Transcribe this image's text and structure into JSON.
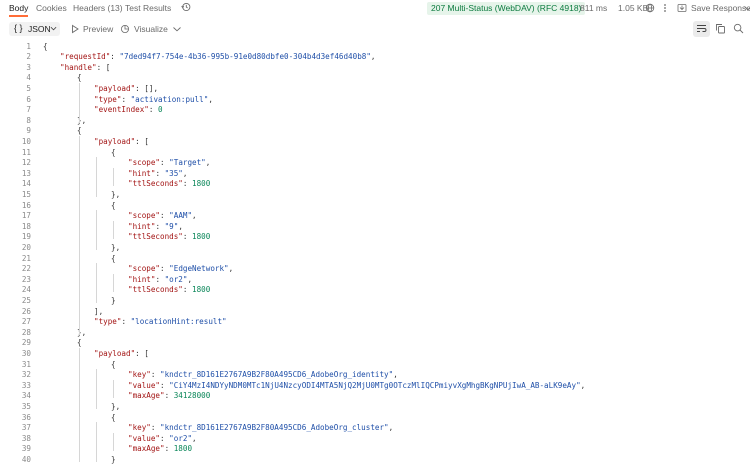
{
  "tabs": {
    "body": "Body",
    "cookies": "Cookies",
    "headers": "Headers (13)",
    "test_results": "Test Results"
  },
  "status": {
    "code_text": "207 Multi-Status (WebDAV) (RFC 4918)",
    "time": "811 ms",
    "size": "1.05 KB",
    "save_response": "Save Response",
    "color": "#0b7a3e"
  },
  "toolbar": {
    "format_icon": "{ }",
    "format": "JSON",
    "preview": "Preview",
    "visualize": "Visualize"
  },
  "icons": [
    "history-icon",
    "globe-icon",
    "more-options-icon",
    "save-icon",
    "chevron-down-icon",
    "play-icon",
    "visualize-icon",
    "wrap-lines-icon",
    "copy-icon",
    "search-icon"
  ],
  "code_lines": [
    [
      {
        "t": "p",
        "v": "{"
      }
    ],
    [
      {
        "t": "k",
        "v": "\"requestId\""
      },
      {
        "t": "p",
        "v": ": "
      },
      {
        "t": "s",
        "v": "\"7ded94f7-754e-4b36-995b-91e0d80dbfe0-304b4d3ef46d40b8\""
      },
      {
        "t": "p",
        "v": ","
      }
    ],
    [
      {
        "t": "k",
        "v": "\"handle\""
      },
      {
        "t": "p",
        "v": ": ["
      }
    ],
    [
      {
        "t": "p",
        "v": "{"
      }
    ],
    [
      {
        "t": "k",
        "v": "\"payload\""
      },
      {
        "t": "p",
        "v": ": [],"
      }
    ],
    [
      {
        "t": "k",
        "v": "\"type\""
      },
      {
        "t": "p",
        "v": ": "
      },
      {
        "t": "s",
        "v": "\"activation:pull\""
      },
      {
        "t": "p",
        "v": ","
      }
    ],
    [
      {
        "t": "k",
        "v": "\"eventIndex\""
      },
      {
        "t": "p",
        "v": ": "
      },
      {
        "t": "n",
        "v": "0"
      }
    ],
    [
      {
        "t": "p",
        "v": "},"
      }
    ],
    [
      {
        "t": "p",
        "v": "{"
      }
    ],
    [
      {
        "t": "k",
        "v": "\"payload\""
      },
      {
        "t": "p",
        "v": ": ["
      }
    ],
    [
      {
        "t": "p",
        "v": "{"
      }
    ],
    [
      {
        "t": "k",
        "v": "\"scope\""
      },
      {
        "t": "p",
        "v": ": "
      },
      {
        "t": "s",
        "v": "\"Target\""
      },
      {
        "t": "p",
        "v": ","
      }
    ],
    [
      {
        "t": "k",
        "v": "\"hint\""
      },
      {
        "t": "p",
        "v": ": "
      },
      {
        "t": "s",
        "v": "\"35\""
      },
      {
        "t": "p",
        "v": ","
      }
    ],
    [
      {
        "t": "k",
        "v": "\"ttlSeconds\""
      },
      {
        "t": "p",
        "v": ": "
      },
      {
        "t": "n",
        "v": "1800"
      }
    ],
    [
      {
        "t": "p",
        "v": "},"
      }
    ],
    [
      {
        "t": "p",
        "v": "{"
      }
    ],
    [
      {
        "t": "k",
        "v": "\"scope\""
      },
      {
        "t": "p",
        "v": ": "
      },
      {
        "t": "s",
        "v": "\"AAM\""
      },
      {
        "t": "p",
        "v": ","
      }
    ],
    [
      {
        "t": "k",
        "v": "\"hint\""
      },
      {
        "t": "p",
        "v": ": "
      },
      {
        "t": "s",
        "v": "\"9\""
      },
      {
        "t": "p",
        "v": ","
      }
    ],
    [
      {
        "t": "k",
        "v": "\"ttlSeconds\""
      },
      {
        "t": "p",
        "v": ": "
      },
      {
        "t": "n",
        "v": "1800"
      }
    ],
    [
      {
        "t": "p",
        "v": "},"
      }
    ],
    [
      {
        "t": "p",
        "v": "{"
      }
    ],
    [
      {
        "t": "k",
        "v": "\"scope\""
      },
      {
        "t": "p",
        "v": ": "
      },
      {
        "t": "s",
        "v": "\"EdgeNetwork\""
      },
      {
        "t": "p",
        "v": ","
      }
    ],
    [
      {
        "t": "k",
        "v": "\"hint\""
      },
      {
        "t": "p",
        "v": ": "
      },
      {
        "t": "s",
        "v": "\"or2\""
      },
      {
        "t": "p",
        "v": ","
      }
    ],
    [
      {
        "t": "k",
        "v": "\"ttlSeconds\""
      },
      {
        "t": "p",
        "v": ": "
      },
      {
        "t": "n",
        "v": "1800"
      }
    ],
    [
      {
        "t": "p",
        "v": "}"
      }
    ],
    [
      {
        "t": "p",
        "v": "],"
      }
    ],
    [
      {
        "t": "k",
        "v": "\"type\""
      },
      {
        "t": "p",
        "v": ": "
      },
      {
        "t": "s",
        "v": "\"locationHint:result\""
      }
    ],
    [
      {
        "t": "p",
        "v": "},"
      }
    ],
    [
      {
        "t": "p",
        "v": "{"
      }
    ],
    [
      {
        "t": "k",
        "v": "\"payload\""
      },
      {
        "t": "p",
        "v": ": ["
      }
    ],
    [
      {
        "t": "p",
        "v": "{"
      }
    ],
    [
      {
        "t": "k",
        "v": "\"key\""
      },
      {
        "t": "p",
        "v": ": "
      },
      {
        "t": "s",
        "v": "\"kndctr_8D161E2767A9B2F80A495CD6_AdobeOrg_identity\""
      },
      {
        "t": "p",
        "v": ","
      }
    ],
    [
      {
        "t": "k",
        "v": "\"value\""
      },
      {
        "t": "p",
        "v": ": "
      },
      {
        "t": "s",
        "v": "\"CiY4MzI4NDYyNDM0MTc1NjU4NzcyODI4MTA5NjQ2MjU0MTg0OTczMlIQCPmiyvXgMhgBKgNPUjIwA_AB-aLK9eAy\""
      },
      {
        "t": "p",
        "v": ","
      }
    ],
    [
      {
        "t": "k",
        "v": "\"maxAge\""
      },
      {
        "t": "p",
        "v": ": "
      },
      {
        "t": "n",
        "v": "34128000"
      }
    ],
    [
      {
        "t": "p",
        "v": "},"
      }
    ],
    [
      {
        "t": "p",
        "v": "{"
      }
    ],
    [
      {
        "t": "k",
        "v": "\"key\""
      },
      {
        "t": "p",
        "v": ": "
      },
      {
        "t": "s",
        "v": "\"kndctr_8D161E2767A9B2F80A495CD6_AdobeOrg_cluster\""
      },
      {
        "t": "p",
        "v": ","
      }
    ],
    [
      {
        "t": "k",
        "v": "\"value\""
      },
      {
        "t": "p",
        "v": ": "
      },
      {
        "t": "s",
        "v": "\"or2\""
      },
      {
        "t": "p",
        "v": ","
      }
    ],
    [
      {
        "t": "k",
        "v": "\"maxAge\""
      },
      {
        "t": "p",
        "v": ": "
      },
      {
        "t": "n",
        "v": "1800"
      }
    ],
    [
      {
        "t": "p",
        "v": "}"
      }
    ]
  ],
  "line_numbers": [
    "1",
    "2",
    "3",
    "4",
    "5",
    "6",
    "7",
    "8",
    "9",
    "10",
    "11",
    "12",
    "13",
    "14",
    "15",
    "16",
    "17",
    "18",
    "19",
    "20",
    "21",
    "22",
    "23",
    "24",
    "25",
    "26",
    "27",
    "28",
    "29",
    "30",
    "31",
    "32",
    "33",
    "34",
    "35",
    "36",
    "37",
    "38",
    "39",
    "40"
  ]
}
